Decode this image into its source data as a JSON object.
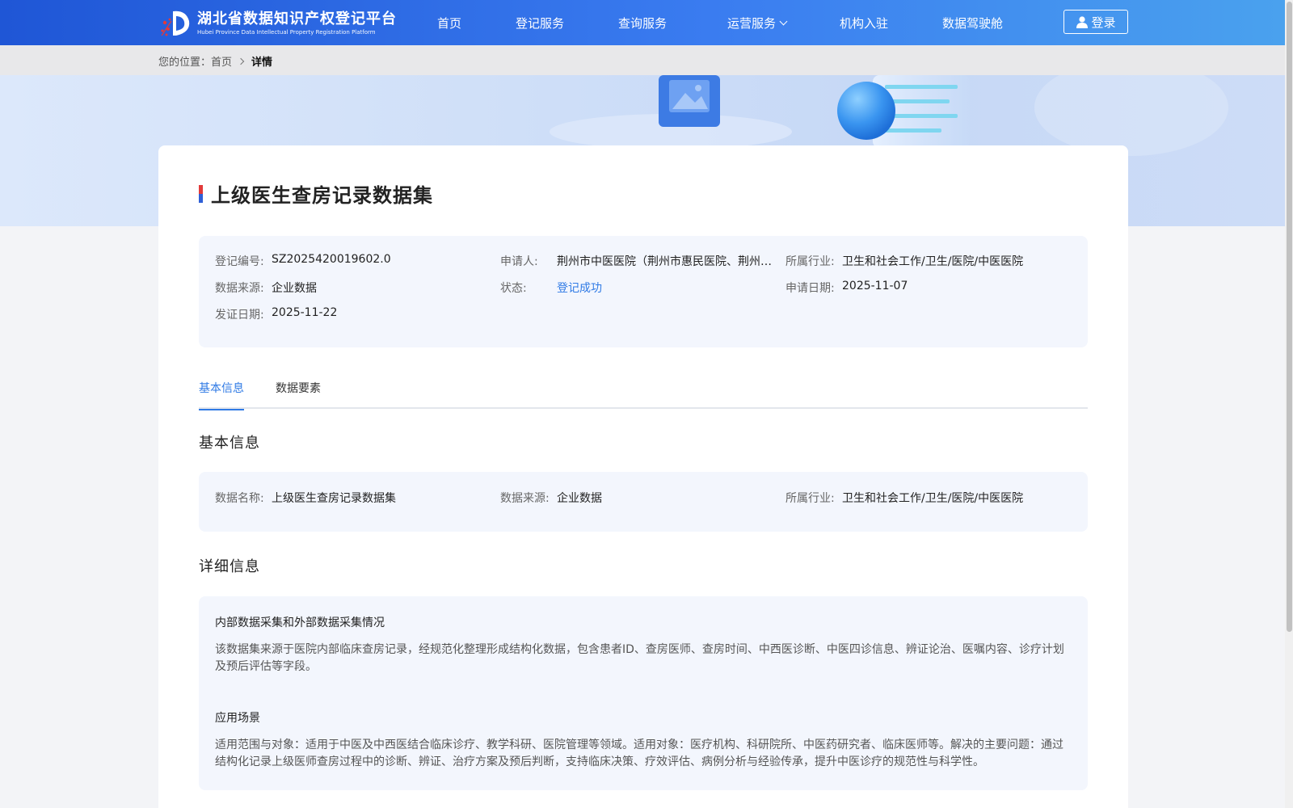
{
  "header": {
    "logo_cn": "湖北省数据知识产权登记平台",
    "logo_en": "Hubei Province Data Intellectual Property Registration Platform",
    "nav": [
      "首页",
      "登记服务",
      "查询服务",
      "运营服务",
      "机构入驻",
      "数据驾驶舱"
    ],
    "login_label": "登录"
  },
  "breadcrumb": {
    "prefix": "您的位置：",
    "home": "首页",
    "current": "详情"
  },
  "detail": {
    "title": "上级医生查房记录数据集",
    "summary": {
      "reg_no_label": "登记编号:",
      "reg_no": "SZ2025420019602.0",
      "applicant_label": "申请人:",
      "applicant": "荆州市中医医院（荆州市惠民医院、荆州…",
      "industry_label": "所属行业:",
      "industry": "卫生和社会工作/卫生/医院/中医医院",
      "source_label": "数据来源:",
      "source": "企业数据",
      "status_label": "状态:",
      "status": "登记成功",
      "apply_date_label": "申请日期:",
      "apply_date": "2025-11-07",
      "cert_date_label": "发证日期:",
      "cert_date": "2025-11-22"
    },
    "tabs": [
      "基本信息",
      "数据要素"
    ],
    "basic_title": "基本信息",
    "basic": {
      "name_label": "数据名称:",
      "name": "上级医生查房记录数据集",
      "source_label": "数据来源:",
      "source": "企业数据",
      "industry_label": "所属行业:",
      "industry": "卫生和社会工作/卫生/医院/中医医院"
    },
    "detail_title": "详细信息",
    "detail_info": {
      "collect_title": "内部数据采集和外部数据采集情况",
      "collect_text": "该数据集来源于医院内部临床查房记录，经规范化整理形成结构化数据，包含患者ID、查房医师、查房时间、中西医诊断、中医四诊信息、辨证论治、医嘱内容、诊疗计划及预后评估等字段。",
      "scene_title": "应用场景",
      "scene_text": "适用范围与对象：适用于中医及中西医结合临床诊疗、教学科研、医院管理等领域。适用对象：医疗机构、科研院所、中医药研究者、临床医师等。解决的主要问题：通过结构化记录上级医师查房过程中的诊断、辨证、治疗方案及预后判断，支持临床决策、疗效评估、病例分析与经验传承，提升中医诊疗的规范性与科学性。"
    }
  },
  "colors": {
    "accent": "#2f7ae5",
    "header_start": "#1f56d6",
    "header_end": "#4aa2ee",
    "panel": "#f3f6fd"
  }
}
